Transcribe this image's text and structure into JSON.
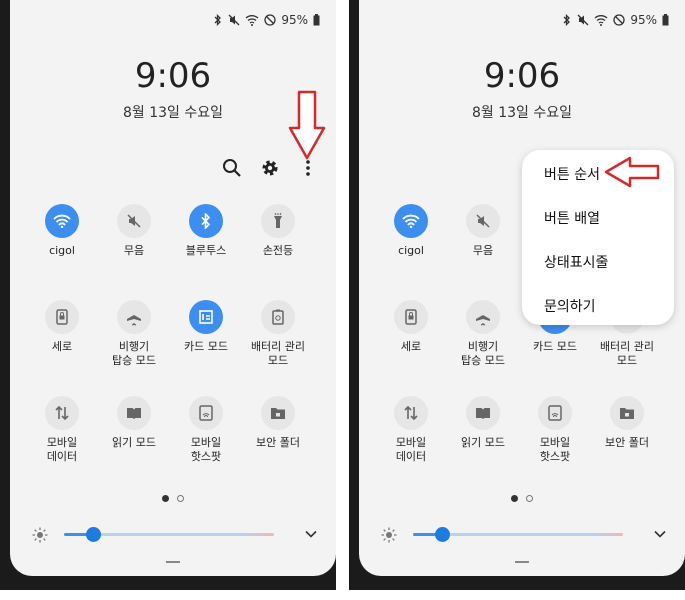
{
  "status": {
    "battery": "95%",
    "icons": [
      "bluetooth-icon",
      "mute-icon",
      "wifi-icon",
      "do-not-disturb-icon",
      "battery-icon"
    ]
  },
  "lockscreen": {
    "time": "9:06",
    "date": "8월 13일 수요일"
  },
  "toolbar": {
    "icons": [
      "search-icon",
      "gear-icon",
      "more-vertical-icon"
    ]
  },
  "tiles": [
    {
      "label": "cigol",
      "icon": "wifi-icon",
      "on": true
    },
    {
      "label": "무음",
      "icon": "mute-icon",
      "on": false
    },
    {
      "label": "블루투스",
      "icon": "bluetooth-icon",
      "on": true
    },
    {
      "label": "손전등",
      "icon": "flashlight-icon",
      "on": false
    },
    {
      "label": "세로",
      "icon": "portrait-lock-icon",
      "on": false
    },
    {
      "label": "비행기\n탑승 모드",
      "icon": "airplane-icon",
      "on": false
    },
    {
      "label": "카드 모드",
      "icon": "card-icon",
      "on": true
    },
    {
      "label": "배터리 관리\n모드",
      "icon": "battery-saver-icon",
      "on": false
    },
    {
      "label": "모바일\n데이터",
      "icon": "mobile-data-icon",
      "on": false
    },
    {
      "label": "읽기 모드",
      "icon": "book-icon",
      "on": false
    },
    {
      "label": "모바일\n핫스팟",
      "icon": "hotspot-icon",
      "on": false
    },
    {
      "label": "보안 폴더",
      "icon": "secure-folder-icon",
      "on": false
    }
  ],
  "menu": {
    "items": [
      "버튼 순서",
      "버튼 배열",
      "상태표시줄",
      "문의하기"
    ]
  },
  "brightness": {
    "level": 0.14
  },
  "colors": {
    "accent": "#3d8ef1",
    "annotation_arrow": "#d42a2a"
  }
}
